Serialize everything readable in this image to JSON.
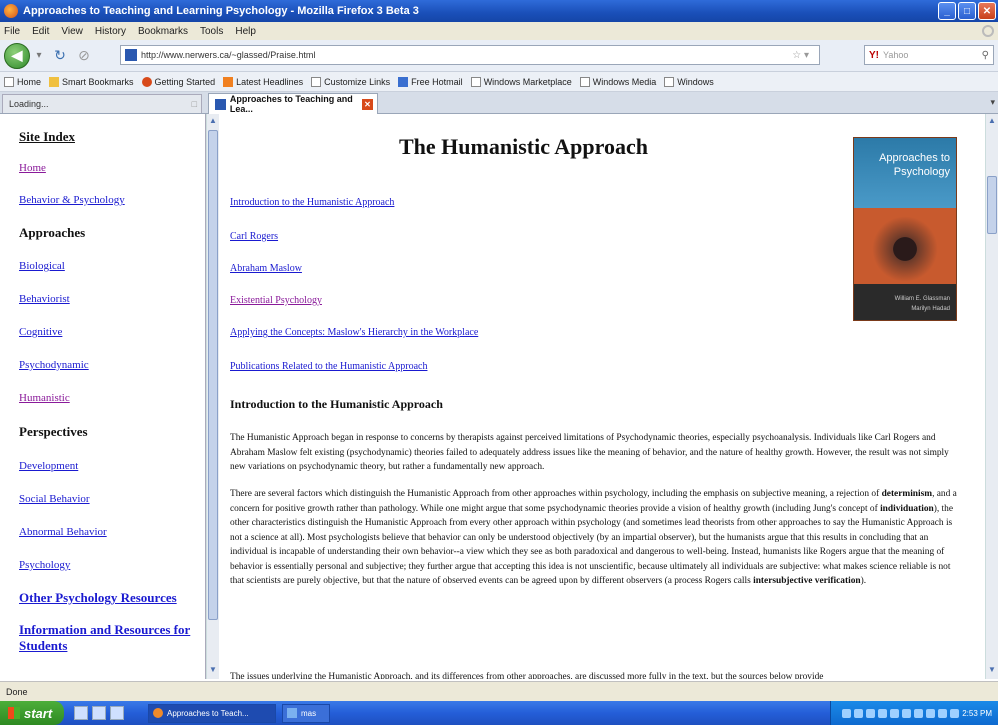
{
  "window": {
    "title": "Approaches to Teaching and Learning Psychology - Mozilla Firefox 3 Beta 3"
  },
  "menu": [
    "File",
    "Edit",
    "View",
    "History",
    "Bookmarks",
    "Tools",
    "Help"
  ],
  "nav": {
    "url": "http://www.nerwers.ca/~glassed/Praise.html",
    "search_placeholder": "Yahoo"
  },
  "bookmarks": [
    {
      "label": "Home",
      "icon": "home-icon"
    },
    {
      "label": "Smart Bookmarks",
      "icon": "folder-icon"
    },
    {
      "label": "Getting Started",
      "icon": "firefox-icon"
    },
    {
      "label": "Latest Headlines",
      "icon": "rss-icon"
    },
    {
      "label": "Customize Links",
      "icon": "page-icon"
    },
    {
      "label": "Free Hotmail",
      "icon": "ms-icon"
    },
    {
      "label": "Windows Marketplace",
      "icon": "page-icon"
    },
    {
      "label": "Windows Media",
      "icon": "page-icon"
    },
    {
      "label": "Windows",
      "icon": "page-icon"
    }
  ],
  "tabs": {
    "loading": "Loading...",
    "active": "Approaches to Teaching and Lea..."
  },
  "sidebar": {
    "site_index": "Site Index",
    "home": "Home",
    "behavior_psychology": "Behavior & Psychology",
    "approaches_head": "Approaches",
    "biological": "Biological",
    "behaviorist": "Behaviorist",
    "cognitive": "Cognitive",
    "psychodynamic": "Psychodynamic",
    "humanistic": "Humanistic",
    "perspectives_head": "Perspectives",
    "development": "Development",
    "social_behavior": "Social Behavior",
    "abnormal_behavior": "Abnormal Behavior",
    "psychology": "Psychology",
    "other_resources": "Other Psychology Resources",
    "info_line1": "Information and Resources for",
    "info_line2": "Students"
  },
  "main": {
    "title": "The Humanistic Approach",
    "links": [
      "Introduction to the Humanistic Approach",
      "Carl Rogers",
      "Abraham Maslow",
      "Existential Psychology",
      "Applying the Concepts: Maslow's Hierarchy in the Workplace",
      "Publications Related to the Humanistic Approach"
    ],
    "intro_heading": "Introduction to the Humanistic Approach",
    "para1": "The Humanistic Approach began in response to concerns by therapists against perceived limitations of Psychodynamic theories, especially psychoanalysis. Individuals like Carl Rogers and Abraham Maslow felt existing (psychodynamic) theories failed to adequately address issues like the meaning of behavior, and the nature of healthy growth. However, the result was not simply new variations on psychodynamic theory, but rather a fundamentally new approach.",
    "para2_a": "There are several factors which distinguish the Humanistic Approach from other approaches within psychology, including the emphasis on subjective meaning, a rejection of ",
    "para2_b1": "determinism",
    "para2_c": ", and a concern for positive growth rather than pathology. While one might argue that some psychodynamic theories provide a vision of healthy growth (including Jung's concept of ",
    "para2_b2": "individuation",
    "para2_d": "), the other characteristics distinguish the Humanistic Approach from every other approach within psychology (and sometimes lead theorists from other approaches to say the Humanistic Approach is not a science at all). Most psychologists believe that behavior can only be understood objectively (by an impartial observer), but the humanists argue that this results in concluding that an individual is incapable of understanding their own behavior--a view which they see as both paradoxical and dangerous to well-being. Instead, humanists like Rogers argue that the meaning of behavior is essentially personal and subjective; they further argue that accepting this idea is not unscientific, because ultimately all individuals are subjective: what makes science reliable is not that scientists are purely objective, but that the nature of observed events can be agreed upon by different observers (a process Rogers calls ",
    "para2_b3": "intersubjective verification",
    "para2_e": ").",
    "para3": "The issues underlying the Humanistic Approach, and its differences from other approaches, are discussed more fully in the text, but the sources below provide"
  },
  "book": {
    "title_line1": "Approaches to",
    "title_line2": "Psychology",
    "author1": "William E. Glassman",
    "author2": "Marilyn Hadad"
  },
  "status": "Done",
  "taskbar": {
    "start": "start",
    "task1": "Approaches to Teach...",
    "task2": "mas"
  },
  "tray": {
    "clock": "2:53 PM"
  }
}
